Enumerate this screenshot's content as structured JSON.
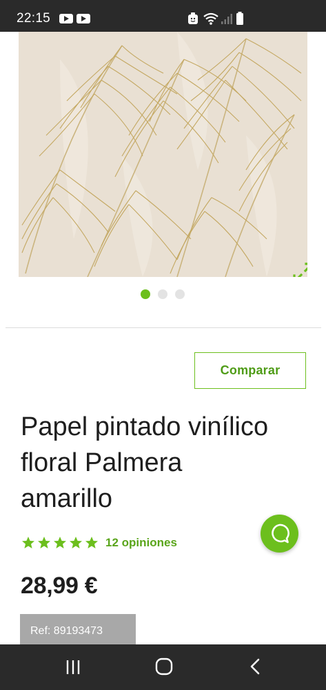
{
  "status_bar": {
    "time": "22:15"
  },
  "gallery": {
    "image_name": "palm-wallpaper",
    "slide_count": 3,
    "active_slide": 1
  },
  "product": {
    "compare_label": "Comparar",
    "title_line1": "Papel pintado vinílico",
    "title_line2": "floral Palmera",
    "title_line3": "amarillo",
    "rating_stars": 5,
    "reviews_label": "12 opiniones",
    "price": "28,99 €",
    "ref": "Ref: 89193473"
  },
  "colors": {
    "accent": "#6cbf1d",
    "accent_text": "#4f9c17",
    "ref_badge_bg": "#a8a8a8",
    "system_bars": "#2a2a2a"
  },
  "icons": {
    "expand": "expand-arrows-icon",
    "chat": "chat-bubble-icon",
    "nav_recent": "recent-apps-icon",
    "nav_home": "home-icon",
    "nav_back": "back-icon"
  }
}
